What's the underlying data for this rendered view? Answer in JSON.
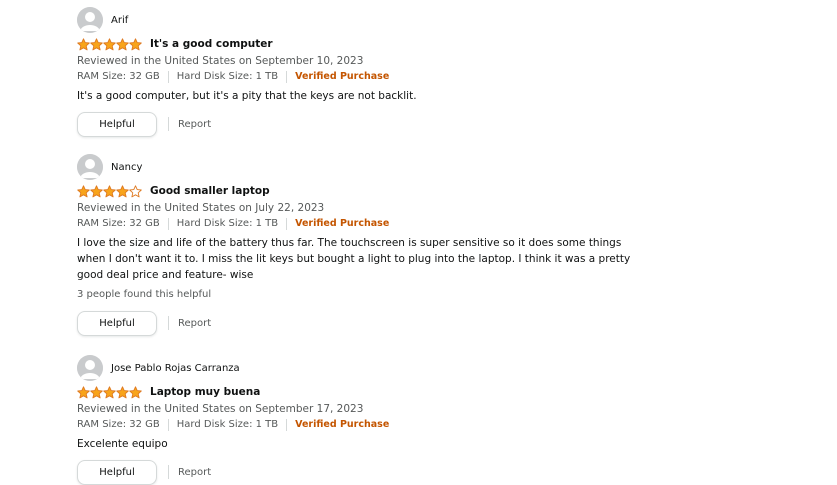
{
  "reviews": [
    {
      "profile_name": "Arif",
      "rating": 5,
      "title": "It's a good computer",
      "date": "Reviewed in the United States on September 10, 2023",
      "ram": "RAM Size: 32 GB",
      "disk": "Hard Disk Size: 1 TB",
      "verified": "Verified Purchase",
      "body": "It's a good computer, but it's a pity that the keys are not backlit.",
      "helpful_count": "",
      "helpful_label": "Helpful",
      "report_label": "Report"
    },
    {
      "profile_name": "Nancy",
      "rating": 4,
      "title": "Good smaller laptop",
      "date": "Reviewed in the United States on July 22, 2023",
      "ram": "RAM Size: 32 GB",
      "disk": "Hard Disk Size: 1 TB",
      "verified": "Verified Purchase",
      "body": "I love the size and life of the battery thus far. The touchscreen is super sensitive so it does some things when I don't want it to. I miss the lit keys but bought a light to plug into the laptop. I think it was a pretty good deal price and feature- wise",
      "helpful_count": "3 people found this helpful",
      "helpful_label": "Helpful",
      "report_label": "Report"
    },
    {
      "profile_name": "Jose Pablo Rojas Carranza",
      "rating": 5,
      "title": "Laptop muy buena",
      "date": "Reviewed in the United States on September 17, 2023",
      "ram": "RAM Size: 32 GB",
      "disk": "Hard Disk Size: 1 TB",
      "verified": "Verified Purchase",
      "body": "Excelente equipo",
      "helpful_count": "",
      "helpful_label": "Helpful",
      "report_label": "Report"
    }
  ],
  "colors": {
    "star_fill": "#f8a41b",
    "star_outline": "#de7921",
    "verified": "#c45500",
    "muted_text": "#565959"
  },
  "icons": {
    "avatar": "default-profile-avatar-icon",
    "star_full": "star-full-icon",
    "star_empty": "star-empty-icon"
  }
}
